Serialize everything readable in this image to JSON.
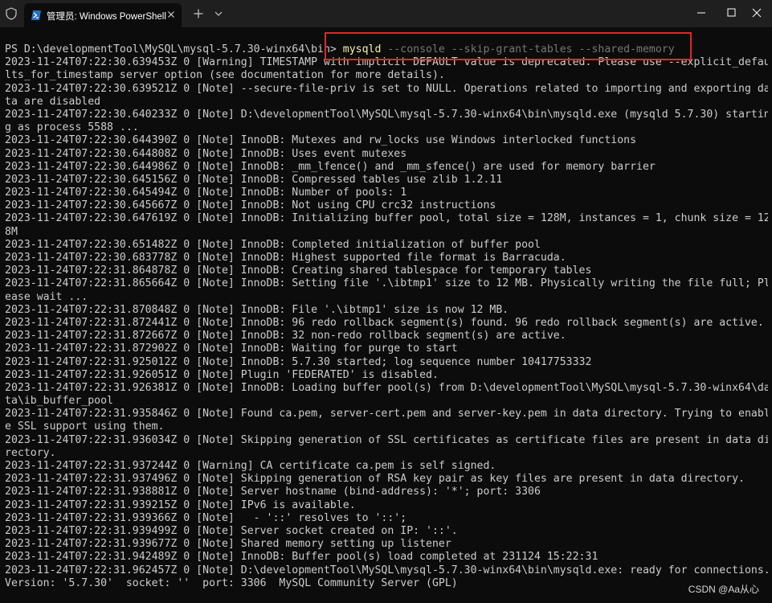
{
  "window": {
    "tab_title": "管理员: Windows PowerShell"
  },
  "terminal": {
    "prompt": "PS D:\\developmentTool\\MySQL\\mysql-5.7.30-winx64\\bin> ",
    "command": "mysqld",
    "command_args": " --console --skip-grant-tables --shared-memory",
    "lines": [
      "2023-11-24T07:22:30.639453Z 0 [Warning] TIMESTAMP with implicit DEFAULT value is deprecated. Please use --explicit_defau",
      "lts_for_timestamp server option (see documentation for more details).",
      "2023-11-24T07:22:30.639521Z 0 [Note] --secure-file-priv is set to NULL. Operations related to importing and exporting da",
      "ta are disabled",
      "2023-11-24T07:22:30.640233Z 0 [Note] D:\\developmentTool\\MySQL\\mysql-5.7.30-winx64\\bin\\mysqld.exe (mysqld 5.7.30) startin",
      "g as process 5588 ...",
      "2023-11-24T07:22:30.644390Z 0 [Note] InnoDB: Mutexes and rw_locks use Windows interlocked functions",
      "2023-11-24T07:22:30.644808Z 0 [Note] InnoDB: Uses event mutexes",
      "2023-11-24T07:22:30.644986Z 0 [Note] InnoDB: _mm_lfence() and _mm_sfence() are used for memory barrier",
      "2023-11-24T07:22:30.645156Z 0 [Note] InnoDB: Compressed tables use zlib 1.2.11",
      "2023-11-24T07:22:30.645494Z 0 [Note] InnoDB: Number of pools: 1",
      "2023-11-24T07:22:30.645667Z 0 [Note] InnoDB: Not using CPU crc32 instructions",
      "2023-11-24T07:22:30.647619Z 0 [Note] InnoDB: Initializing buffer pool, total size = 128M, instances = 1, chunk size = 12",
      "8M",
      "2023-11-24T07:22:30.651482Z 0 [Note] InnoDB: Completed initialization of buffer pool",
      "2023-11-24T07:22:30.683778Z 0 [Note] InnoDB: Highest supported file format is Barracuda.",
      "2023-11-24T07:22:31.864878Z 0 [Note] InnoDB: Creating shared tablespace for temporary tables",
      "2023-11-24T07:22:31.865664Z 0 [Note] InnoDB: Setting file '.\\ibtmp1' size to 12 MB. Physically writing the file full; Pl",
      "ease wait ...",
      "2023-11-24T07:22:31.870848Z 0 [Note] InnoDB: File '.\\ibtmp1' size is now 12 MB.",
      "2023-11-24T07:22:31.872441Z 0 [Note] InnoDB: 96 redo rollback segment(s) found. 96 redo rollback segment(s) are active.",
      "2023-11-24T07:22:31.872667Z 0 [Note] InnoDB: 32 non-redo rollback segment(s) are active.",
      "2023-11-24T07:22:31.872902Z 0 [Note] InnoDB: Waiting for purge to start",
      "2023-11-24T07:22:31.925012Z 0 [Note] InnoDB: 5.7.30 started; log sequence number 10417753332",
      "2023-11-24T07:22:31.926051Z 0 [Note] Plugin 'FEDERATED' is disabled.",
      "2023-11-24T07:22:31.926381Z 0 [Note] InnoDB: Loading buffer pool(s) from D:\\developmentTool\\MySQL\\mysql-5.7.30-winx64\\da",
      "ta\\ib_buffer_pool",
      "2023-11-24T07:22:31.935846Z 0 [Note] Found ca.pem, server-cert.pem and server-key.pem in data directory. Trying to enabl",
      "e SSL support using them.",
      "2023-11-24T07:22:31.936034Z 0 [Note] Skipping generation of SSL certificates as certificate files are present in data di",
      "rectory.",
      "2023-11-24T07:22:31.937244Z 0 [Warning] CA certificate ca.pem is self signed.",
      "2023-11-24T07:22:31.937496Z 0 [Note] Skipping generation of RSA key pair as key files are present in data directory.",
      "2023-11-24T07:22:31.938881Z 0 [Note] Server hostname (bind-address): '*'; port: 3306",
      "2023-11-24T07:22:31.939215Z 0 [Note] IPv6 is available.",
      "2023-11-24T07:22:31.939366Z 0 [Note]   - '::' resolves to '::';",
      "2023-11-24T07:22:31.939499Z 0 [Note] Server socket created on IP: '::'.",
      "2023-11-24T07:22:31.939677Z 0 [Note] Shared memory setting up listener",
      "2023-11-24T07:22:31.942489Z 0 [Note] InnoDB: Buffer pool(s) load completed at 231124 15:22:31",
      "2023-11-24T07:22:31.962457Z 0 [Note] D:\\developmentTool\\MySQL\\mysql-5.7.30-winx64\\bin\\mysqld.exe: ready for connections.",
      "Version: '5.7.30'  socket: ''  port: 3306  MySQL Community Server (GPL)"
    ]
  },
  "watermark": "CSDN @Aa从心",
  "colors": {
    "titlebar": "#1f1f1f",
    "background": "#0c0c0c",
    "text": "#cccccc",
    "command": "#f9f1a5",
    "args": "#767676",
    "highlight_box": "#e0282d"
  },
  "icons": {
    "shield": "shield-icon",
    "powershell": "powershell-icon",
    "close": "close-icon",
    "plus": "plus-icon",
    "chevron": "chevron-down-icon",
    "minimize": "minimize-icon",
    "maximize": "maximize-icon",
    "window_close": "window-close-icon"
  }
}
